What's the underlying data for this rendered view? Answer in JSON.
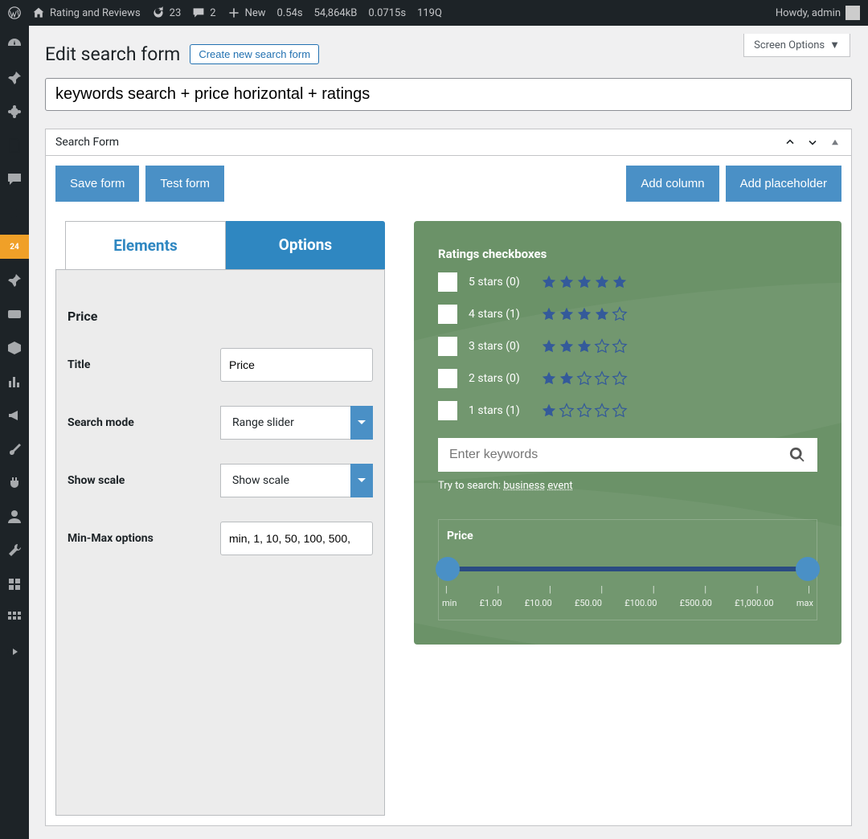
{
  "adminbar": {
    "site": "Rating and Reviews",
    "updates": "23",
    "comments": "2",
    "new": "New",
    "stats": [
      "0.54s",
      "54,864kB",
      "0.0715s",
      "119Q"
    ],
    "howdy": "Howdy, admin"
  },
  "active_badge": "24",
  "screen_options": "Screen Options",
  "page": {
    "title": "Edit search form",
    "create_btn": "Create new search form",
    "form_name": "keywords search + price horizontal + ratings"
  },
  "metabox": {
    "title": "Search Form"
  },
  "buttons": {
    "save": "Save form",
    "test": "Test form",
    "add_col": "Add column",
    "add_ph": "Add placeholder"
  },
  "tabs": {
    "elements": "Elements",
    "options": "Options"
  },
  "options": {
    "section": "Price",
    "fields": {
      "title": {
        "label": "Title",
        "value": "Price"
      },
      "mode": {
        "label": "Search mode",
        "value": "Range slider"
      },
      "scale": {
        "label": "Show scale",
        "value": "Show scale"
      },
      "minmax": {
        "label": "Min-Max options",
        "value": "min, 1, 10, 50, 100, 500,"
      }
    }
  },
  "preview": {
    "ratings_title": "Ratings checkboxes",
    "ratings": [
      {
        "label": "5 stars (0)",
        "stars": 5
      },
      {
        "label": "4 stars (1)",
        "stars": 4
      },
      {
        "label": "3 stars (0)",
        "stars": 3
      },
      {
        "label": "2 stars (0)",
        "stars": 2
      },
      {
        "label": "1 stars (1)",
        "stars": 1
      }
    ],
    "search_placeholder": "Enter keywords",
    "try_prefix": "Try to search: ",
    "try_terms": [
      "business",
      "event"
    ],
    "slider": {
      "title": "Price",
      "labels": [
        "min",
        "£1.00",
        "£10.00",
        "£50.00",
        "£100.00",
        "£500.00",
        "£1,000.00",
        "max"
      ]
    }
  }
}
